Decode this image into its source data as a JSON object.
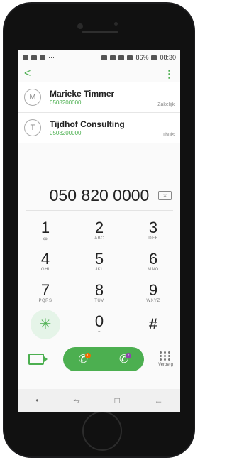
{
  "status": {
    "time": "08:30",
    "battery": "86%",
    "left_icons": [
      "image-icon",
      "mail-icon",
      "mail-icon",
      "more-icon"
    ],
    "right_icons": [
      "alarm-icon",
      "wifi-icon",
      "signal-icon",
      "signal-icon",
      "battery-icon"
    ]
  },
  "appbar": {
    "back": "<",
    "menu": "⋮"
  },
  "contacts": [
    {
      "initial": "M",
      "name": "Marieke Timmer",
      "number": "0508200000",
      "type": "Zakelijk"
    },
    {
      "initial": "T",
      "name": "Tijdhof Consulting",
      "number": "0508200000",
      "type": "Thuis"
    }
  ],
  "number": "050 820 0000",
  "backspace": "✕",
  "keypad": [
    {
      "digit": "1",
      "letters": "ꝏ"
    },
    {
      "digit": "2",
      "letters": "ABC"
    },
    {
      "digit": "3",
      "letters": "DEF"
    },
    {
      "digit": "4",
      "letters": "GHI"
    },
    {
      "digit": "5",
      "letters": "JKL"
    },
    {
      "digit": "6",
      "letters": "MNO"
    },
    {
      "digit": "7",
      "letters": "PQRS"
    },
    {
      "digit": "8",
      "letters": "TUV"
    },
    {
      "digit": "9",
      "letters": "WXYZ"
    },
    {
      "digit": "✳",
      "letters": ""
    },
    {
      "digit": "0",
      "letters": "+"
    },
    {
      "digit": "#",
      "letters": ""
    }
  ],
  "actions": {
    "handset": "✆",
    "sim1": "1",
    "sim2": "2",
    "hide_label": "Verberg"
  },
  "nav": {
    "recents": "⥊",
    "home": "□",
    "back": "←",
    "dot": "•"
  },
  "colors": {
    "accent": "#4caf50",
    "sim1": "#ef6c00",
    "sim2": "#8e44ad"
  }
}
